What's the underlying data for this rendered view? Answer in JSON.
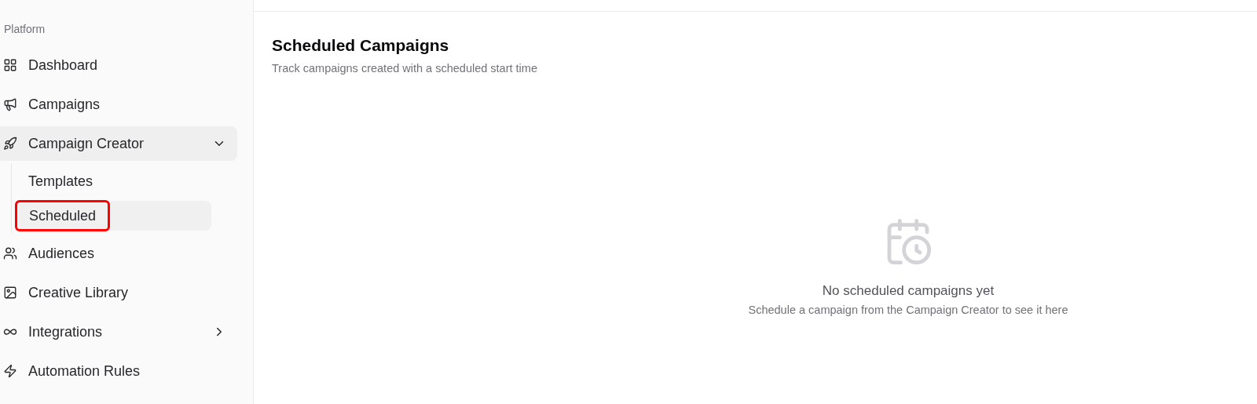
{
  "sidebar": {
    "section_label": "Platform",
    "items": [
      {
        "kind": "link",
        "label": "Dashboard"
      },
      {
        "kind": "link",
        "label": "Campaigns"
      },
      {
        "kind": "group",
        "label": "Campaign Creator",
        "expanded": true,
        "children": [
          {
            "label": "Templates",
            "selected": false,
            "highlighted": false
          },
          {
            "label": "Scheduled",
            "selected": true,
            "highlighted": true
          }
        ]
      },
      {
        "kind": "link",
        "label": "Audiences"
      },
      {
        "kind": "link",
        "label": "Creative Library"
      },
      {
        "kind": "group",
        "label": "Integrations",
        "expanded": false
      },
      {
        "kind": "link",
        "label": "Automation Rules"
      }
    ]
  },
  "page": {
    "title": "Scheduled Campaigns",
    "subtitle": "Track campaigns created with a scheduled start time"
  },
  "empty_state": {
    "title": "No scheduled campaigns yet",
    "message": "Schedule a campaign from the Campaign Creator to see it here"
  }
}
